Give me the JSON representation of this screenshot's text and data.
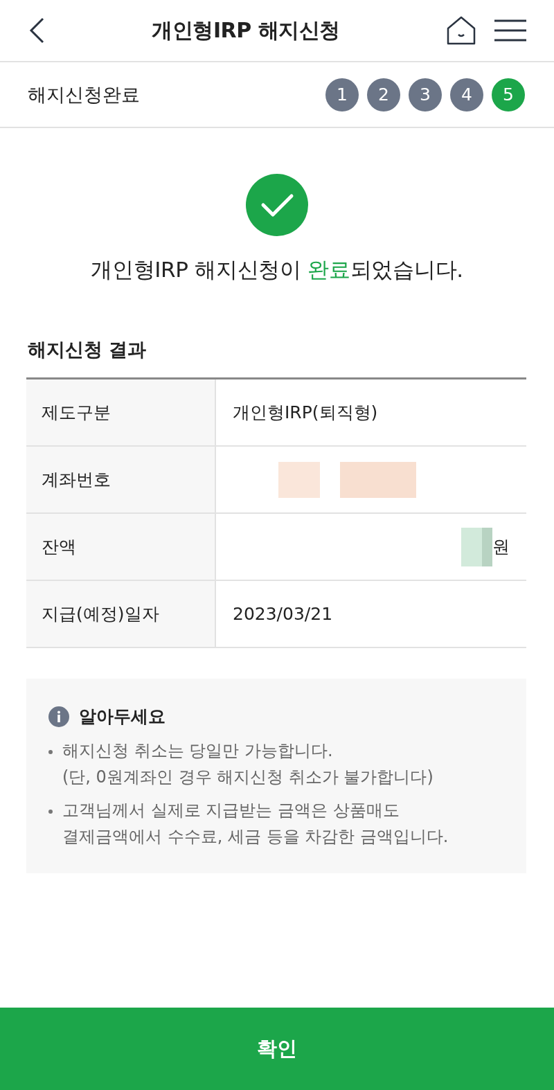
{
  "header": {
    "title": "개인형IRP 해지신청"
  },
  "progress": {
    "label": "해지신청완료",
    "steps": [
      {
        "label": "1",
        "selected": false
      },
      {
        "label": "2",
        "selected": false
      },
      {
        "label": "3",
        "selected": false
      },
      {
        "label": "4",
        "selected": false
      },
      {
        "label": "5",
        "selected": true
      }
    ]
  },
  "result_message": {
    "before": "개인형IRP 해지신청이 ",
    "highlight": "완료",
    "after": "되었습니다."
  },
  "result_section": {
    "title": "해지신청 결과",
    "rows": [
      {
        "label": "제도구분",
        "kind": "text",
        "value": "개인형IRP(퇴직형)"
      },
      {
        "label": "계좌번호",
        "kind": "redacted"
      },
      {
        "label": "잔액",
        "kind": "amount",
        "value": "원"
      },
      {
        "label": "지급(예정)일자",
        "kind": "text",
        "value": "2023/03/21"
      }
    ]
  },
  "notice": {
    "title": "알아두세요",
    "items": [
      {
        "lines": [
          "해지신청 취소는 당일만 가능합니다.",
          "(단, 0원계좌인 경우 해지신청 취소가 불가합니다)"
        ]
      },
      {
        "lines": [
          "고객님께서 실제로 지급받는 금액은 상품매도",
          "결제금액에서 수수료, 세금 등을 차감한 금액입니다."
        ]
      }
    ]
  },
  "confirm_button": {
    "label": "확인"
  }
}
